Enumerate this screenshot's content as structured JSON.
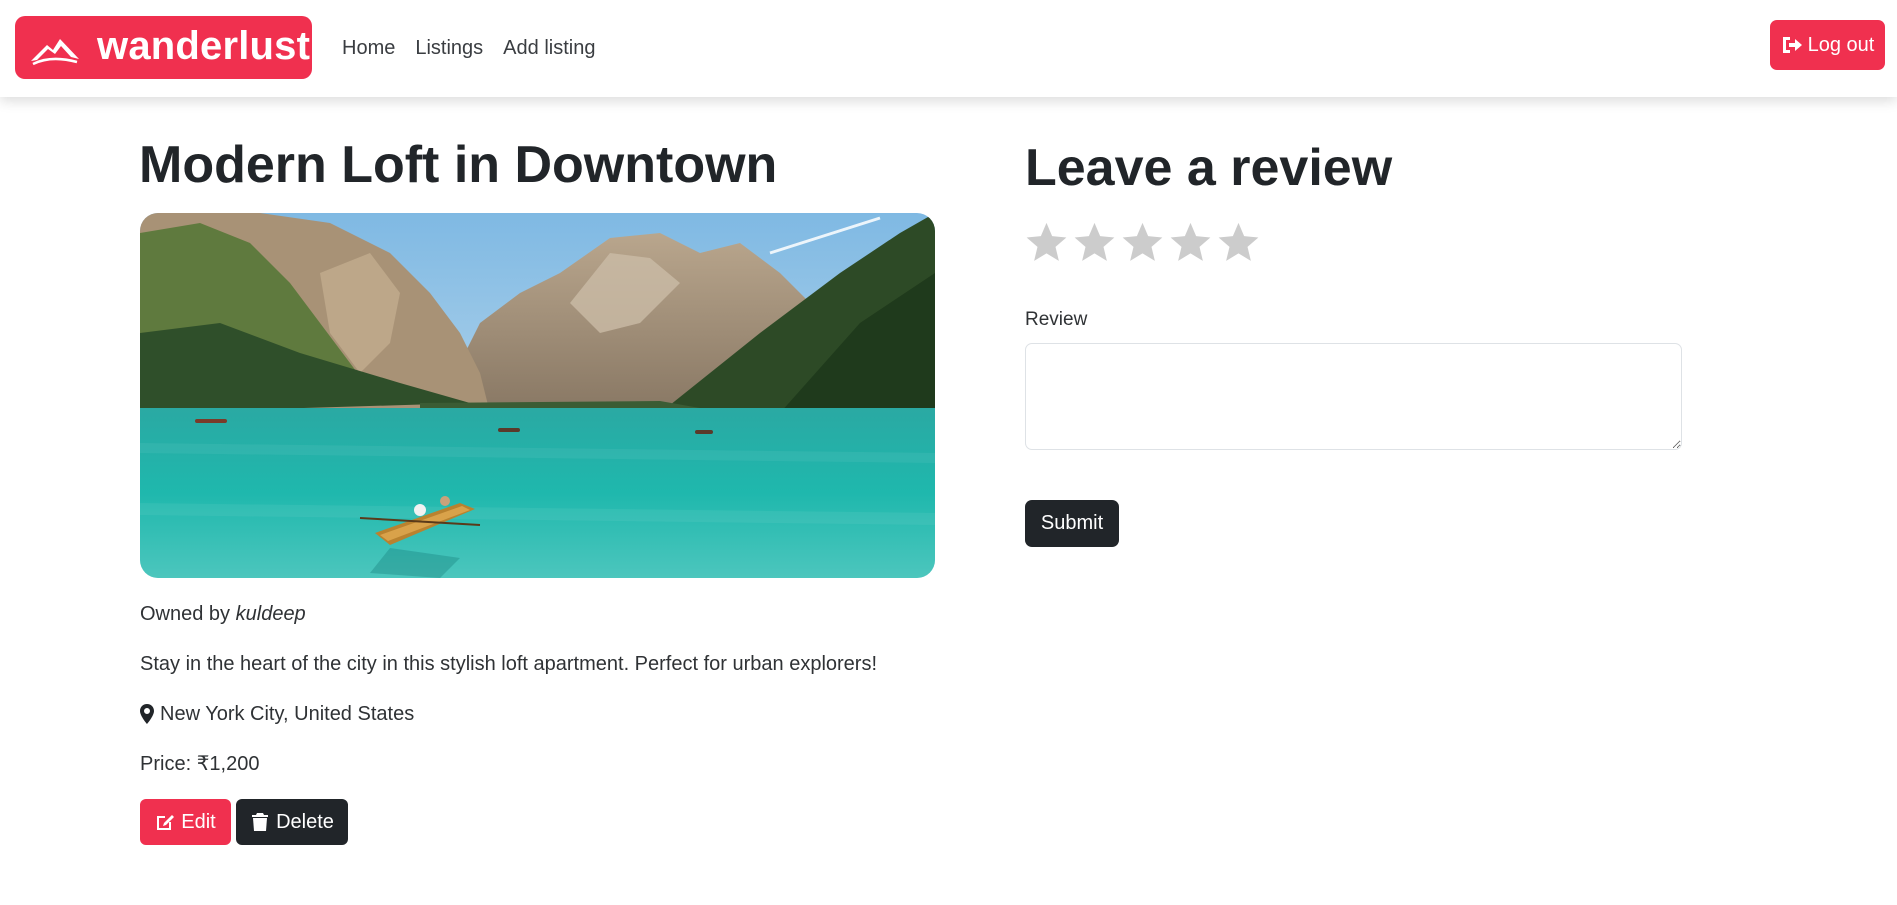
{
  "navbar": {
    "brand": "wanderlust",
    "links": [
      {
        "label": "Home"
      },
      {
        "label": "Listings"
      },
      {
        "label": "Add listing"
      }
    ],
    "logout_label": "Log out"
  },
  "listing": {
    "title": "Modern Loft in Downtown",
    "owner_prefix": "Owned by",
    "owner": "kuldeep",
    "description": "Stay in the heart of the city in this stylish loft apartment. Perfect for urban explorers!",
    "location": "New York City, United States",
    "price_label": "Price:",
    "price": "₹1,200",
    "edit_label": "Edit",
    "delete_label": "Delete"
  },
  "review": {
    "heading": "Leave a review",
    "rating": 0,
    "max_rating": 5,
    "label": "Review",
    "text_value": "",
    "submit_label": "Submit"
  },
  "colors": {
    "brand": "#f0304f",
    "dark": "#212529",
    "star_empty": "#cccccc"
  }
}
